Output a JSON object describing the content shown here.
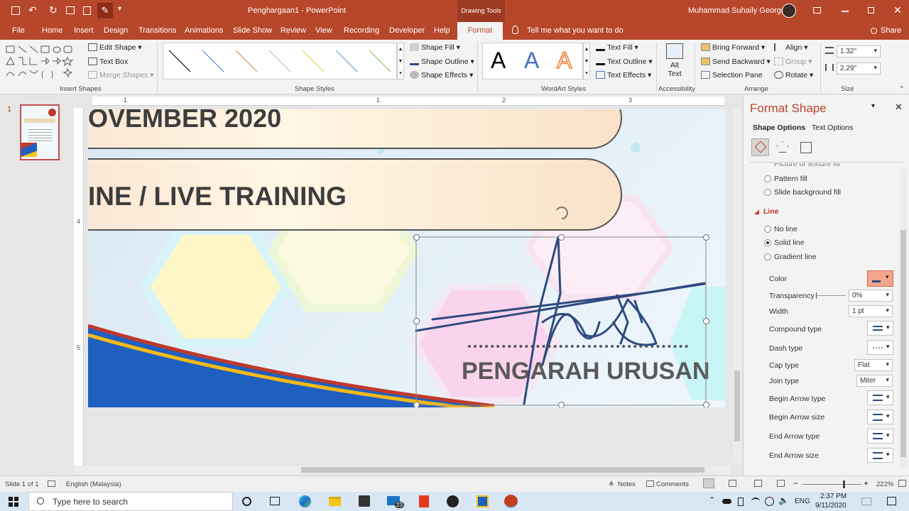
{
  "title_bar": {
    "document_title": "Penghargaan1 - PowerPoint",
    "context_tab_group": "Drawing Tools",
    "user_name": "Muhammad Suhaily George"
  },
  "tabs": [
    "File",
    "Home",
    "Insert",
    "Design",
    "Transitions",
    "Animations",
    "Slide Show",
    "Review",
    "View",
    "Recording",
    "Developer",
    "Help",
    "Format"
  ],
  "tell_me": "Tell me what you want to do",
  "share": "Share",
  "ribbon": {
    "insert_shapes": {
      "edit_shape": "Edit Shape",
      "text_box": "Text Box",
      "merge_shapes": "Merge Shapes",
      "group_label": "Insert Shapes"
    },
    "shape_styles": {
      "fill": "Shape Fill",
      "outline": "Shape Outline",
      "effects": "Shape Effects",
      "group_label": "Shape Styles"
    },
    "wordart": {
      "sample": "A",
      "text_fill": "Text Fill",
      "text_outline": "Text Outline",
      "text_effects": "Text Effects",
      "group_label": "WordArt Styles"
    },
    "accessibility": {
      "alt_text_line1": "Alt",
      "alt_text_line2": "Text",
      "group_label": "Accessibility"
    },
    "arrange": {
      "bring_forward": "Bring Forward",
      "send_backward": "Send Backward",
      "selection_pane": "Selection Pane",
      "align": "Align",
      "group": "Group",
      "rotate": "Rotate",
      "group_label": "Arrange"
    },
    "size": {
      "height": "1.32\"",
      "width": "2.29\"",
      "group_label": "Size"
    }
  },
  "thumbnail": {
    "number": "1"
  },
  "ruler": {
    "h": [
      "1",
      "1",
      "2",
      "3"
    ],
    "v": [
      "4",
      "5"
    ]
  },
  "slide": {
    "banner1": "OVEMBER 2020",
    "banner2": "INE / LIVE TRAINING",
    "caption": "PENGARAH URUSAN"
  },
  "pane": {
    "title": "Format Shape",
    "tab_shape": "Shape Options",
    "tab_text": "Text Options",
    "fill_items": [
      "Picture or texture fill",
      "Pattern fill",
      "Slide background fill"
    ],
    "line_header": "Line",
    "line_options": [
      {
        "label": "No line",
        "selected": false
      },
      {
        "label": "Solid line",
        "selected": true
      },
      {
        "label": "Gradient line",
        "selected": false
      }
    ],
    "color": "Color",
    "transparency": "Transparency",
    "transparency_value": "0%",
    "width": "Width",
    "width_value": "1 pt",
    "compound_type": "Compound type",
    "dash_type": "Dash type",
    "cap_type": "Cap type",
    "cap_value": "Flat",
    "join_type": "Join type",
    "join_value": "Miter",
    "begin_arrow_type": "Begin Arrow type",
    "begin_arrow_size": "Begin Arrow size",
    "end_arrow_type": "End Arrow type",
    "end_arrow_size": "End Arrow size"
  },
  "status": {
    "slide_info": "Slide 1 of 1",
    "language": "English (Malaysia)",
    "notes": "Notes",
    "comments": "Comments",
    "zoom": "222%"
  },
  "taskbar": {
    "search_placeholder": "Type here to search",
    "badge": "23",
    "lang": "ENG",
    "time": "2:37 PM",
    "date": "9/11/2020"
  },
  "colors": {
    "accent": "#b7472a",
    "signature": "#2f4a7f",
    "line_header": "#c0392b",
    "color_button": "#f2a58c"
  }
}
